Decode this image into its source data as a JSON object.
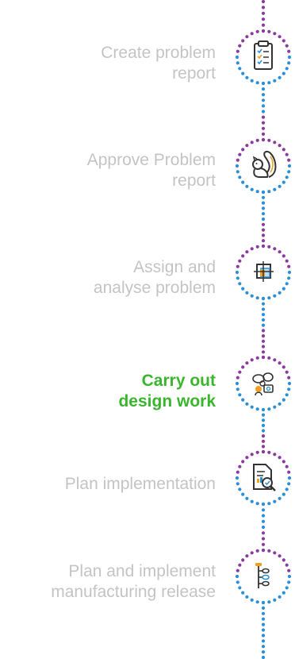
{
  "colors": {
    "purple": "#8b3a9e",
    "blue": "#2b8fd6",
    "active_text": "#3ab52e",
    "inactive_text": "#c4c4c4"
  },
  "steps": [
    {
      "line1": "Create problem",
      "line2": "report",
      "icon": "clipboard-checklist-icon",
      "active": false
    },
    {
      "line1": "Approve Problem",
      "line2": "report",
      "icon": "squirrel-icon",
      "active": false
    },
    {
      "line1": "Assign and",
      "line2": "analyse problem",
      "icon": "layered-squares-icon",
      "active": false
    },
    {
      "line1": "Carry out",
      "line2": "design work",
      "icon": "team-ideas-icon",
      "active": true
    },
    {
      "line1": "Plan implementation",
      "line2": "",
      "icon": "document-magnifier-icon",
      "active": false
    },
    {
      "line1": "Plan and implement",
      "line2": "manufacturing release",
      "icon": "flow-tree-icon",
      "active": false
    }
  ]
}
